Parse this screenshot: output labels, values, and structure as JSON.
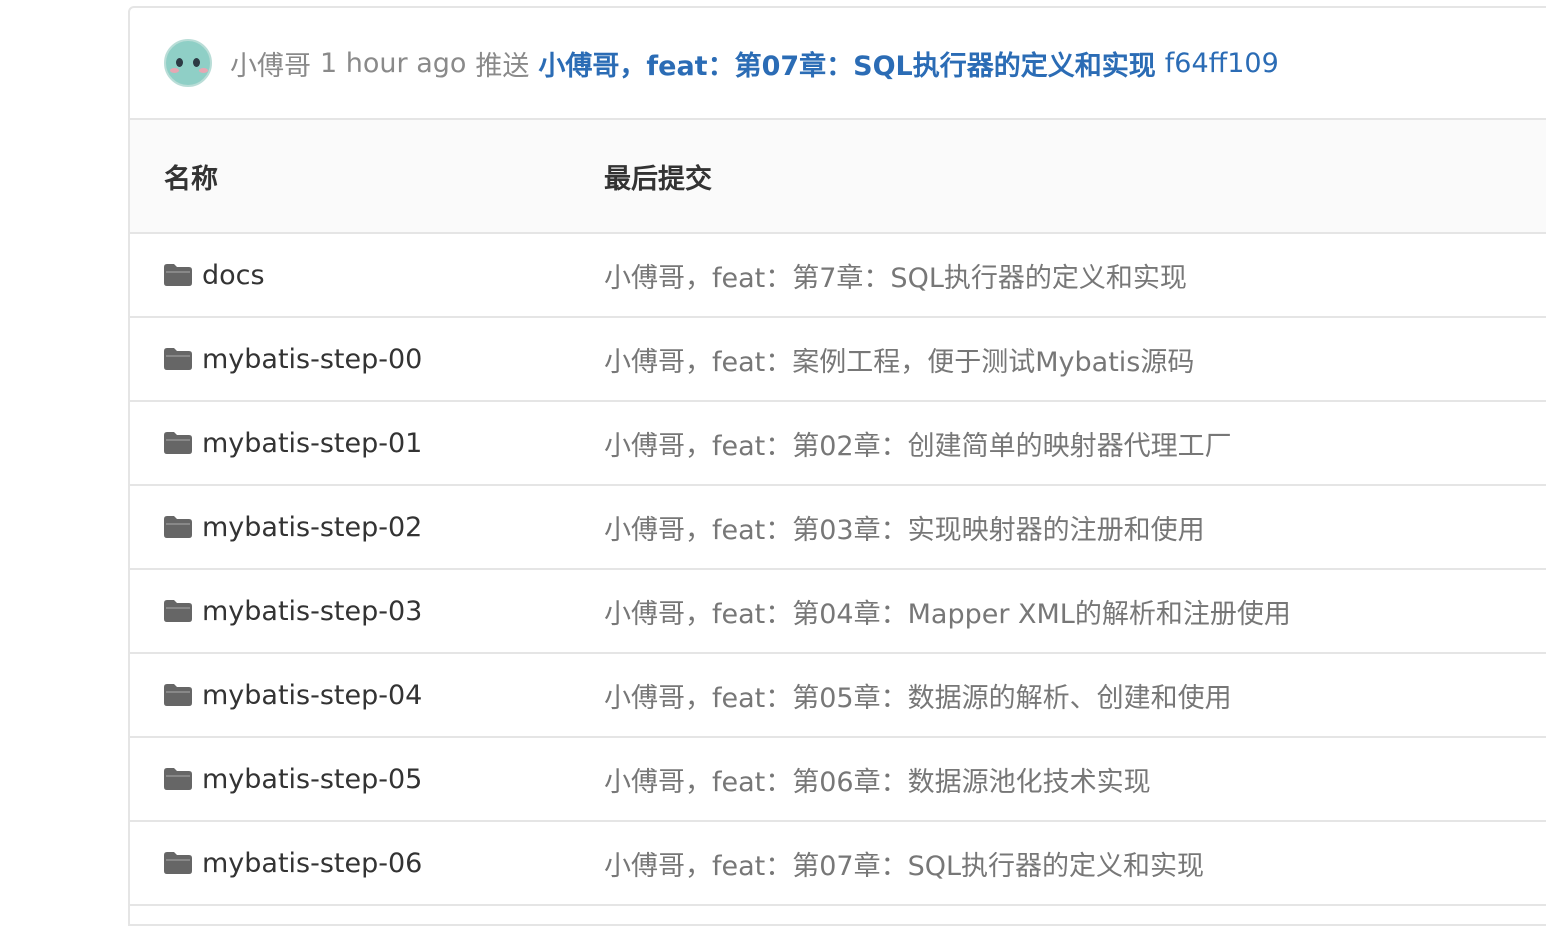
{
  "last_commit": {
    "author": "小傅哥",
    "time": "1 hour ago",
    "action": "推送",
    "message": "小傅哥，feat：第07章：SQL执行器的定义和实现",
    "sha": "f64ff109"
  },
  "table": {
    "headers": {
      "name": "名称",
      "last_commit": "最后提交"
    },
    "rows": [
      {
        "name": "docs",
        "commit": "小傅哥，feat：第7章：SQL执行器的定义和实现",
        "icon": "folder-icon"
      },
      {
        "name": "mybatis-step-00",
        "commit": "小傅哥，feat：案例工程，便于测试Mybatis源码",
        "icon": "folder-icon"
      },
      {
        "name": "mybatis-step-01",
        "commit": "小傅哥，feat：第02章：创建简单的映射器代理工厂",
        "icon": "folder-icon"
      },
      {
        "name": "mybatis-step-02",
        "commit": "小傅哥，feat：第03章：实现映射器的注册和使用",
        "icon": "folder-icon"
      },
      {
        "name": "mybatis-step-03",
        "commit": "小傅哥，feat：第04章：Mapper XML的解析和注册使用",
        "icon": "folder-icon"
      },
      {
        "name": "mybatis-step-04",
        "commit": "小傅哥，feat：第05章：数据源的解析、创建和使用",
        "icon": "folder-icon"
      },
      {
        "name": "mybatis-step-05",
        "commit": "小傅哥，feat：第06章：数据源池化技术实现",
        "icon": "folder-icon"
      },
      {
        "name": "mybatis-step-06",
        "commit": "小傅哥，feat：第07章：SQL执行器的定义和实现",
        "icon": "folder-icon"
      }
    ]
  },
  "colors": {
    "link": "#2b6cb5",
    "muted_text": "#8a8a8a",
    "border": "#e5e5e5",
    "header_bg": "#fafafa",
    "folder_icon": "#666666"
  }
}
